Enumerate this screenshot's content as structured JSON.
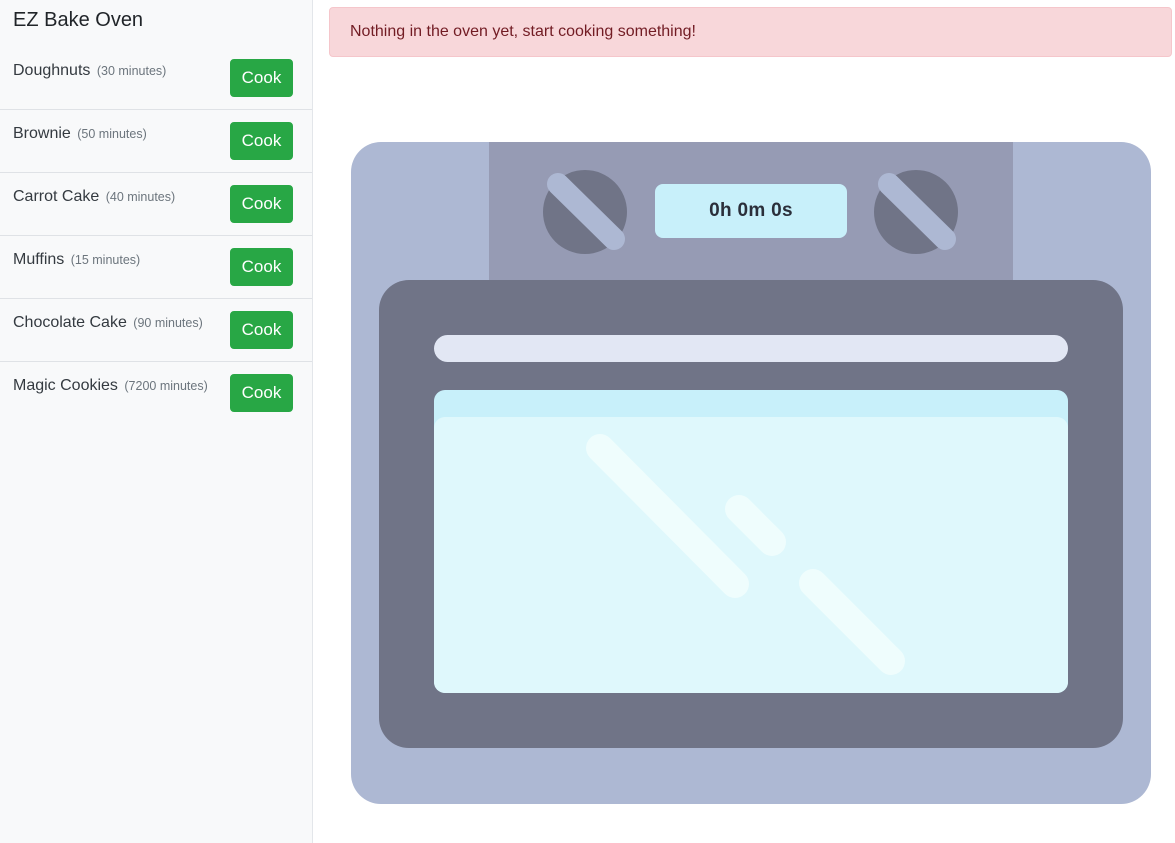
{
  "sidebar": {
    "title": "EZ Bake Oven",
    "items": [
      {
        "name": "Doughnuts",
        "duration": "(30 minutes)",
        "action": "Cook"
      },
      {
        "name": "Brownie",
        "duration": "(50 minutes)",
        "action": "Cook"
      },
      {
        "name": "Carrot Cake",
        "duration": "(40 minutes)",
        "action": "Cook"
      },
      {
        "name": "Muffins",
        "duration": "(15 minutes)",
        "action": "Cook"
      },
      {
        "name": "Chocolate Cake",
        "duration": "(90 minutes)",
        "action": "Cook"
      },
      {
        "name": "Magic Cookies",
        "duration": "(7200 minutes)",
        "action": "Cook"
      }
    ]
  },
  "alert": {
    "message": "Nothing in the oven yet, start cooking something!"
  },
  "oven": {
    "timer": "0h 0m 0s"
  },
  "colors": {
    "cook_button": "#28a745",
    "alert_background": "#f8d7da",
    "alert_text": "#721c24",
    "oven_body": "#adb8d3",
    "oven_control_panel": "#969bb4",
    "oven_door": "#707487",
    "oven_window": "#dff8fc",
    "timer_display": "#c8f0fa"
  },
  "icons": [
    "oven-illustration",
    "left-knob-icon",
    "right-knob-icon"
  ]
}
